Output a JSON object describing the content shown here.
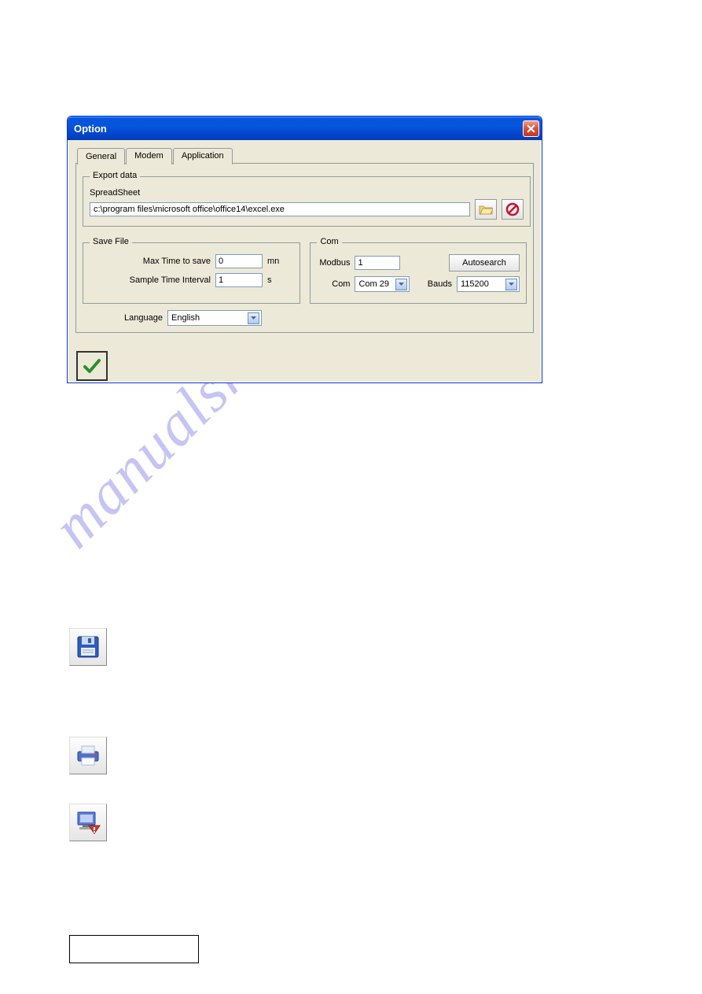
{
  "dialog": {
    "title": "Option",
    "tabs": [
      "General",
      "Modem",
      "Application"
    ],
    "export": {
      "group_title": "Export data",
      "spreadsheet_label": "SpreadSheet",
      "path": "c:\\program files\\microsoft office\\office14\\excel.exe"
    },
    "save": {
      "group_title": "Save File",
      "max_time_label": "Max Time to save",
      "max_time_value": "0",
      "max_time_unit": "mn",
      "interval_label": "Sample Time Interval",
      "interval_value": "1",
      "interval_unit": "s"
    },
    "com": {
      "group_title": "Com",
      "modbus_label": "Modbus",
      "modbus_value": "1",
      "autosearch_label": "Autosearch",
      "com_label": "Com",
      "com_value": "Com 29",
      "bauds_label": "Bauds",
      "bauds_value": "115200"
    },
    "language_label": "Language",
    "language_value": "English"
  },
  "watermark_text": "manualshive.com"
}
